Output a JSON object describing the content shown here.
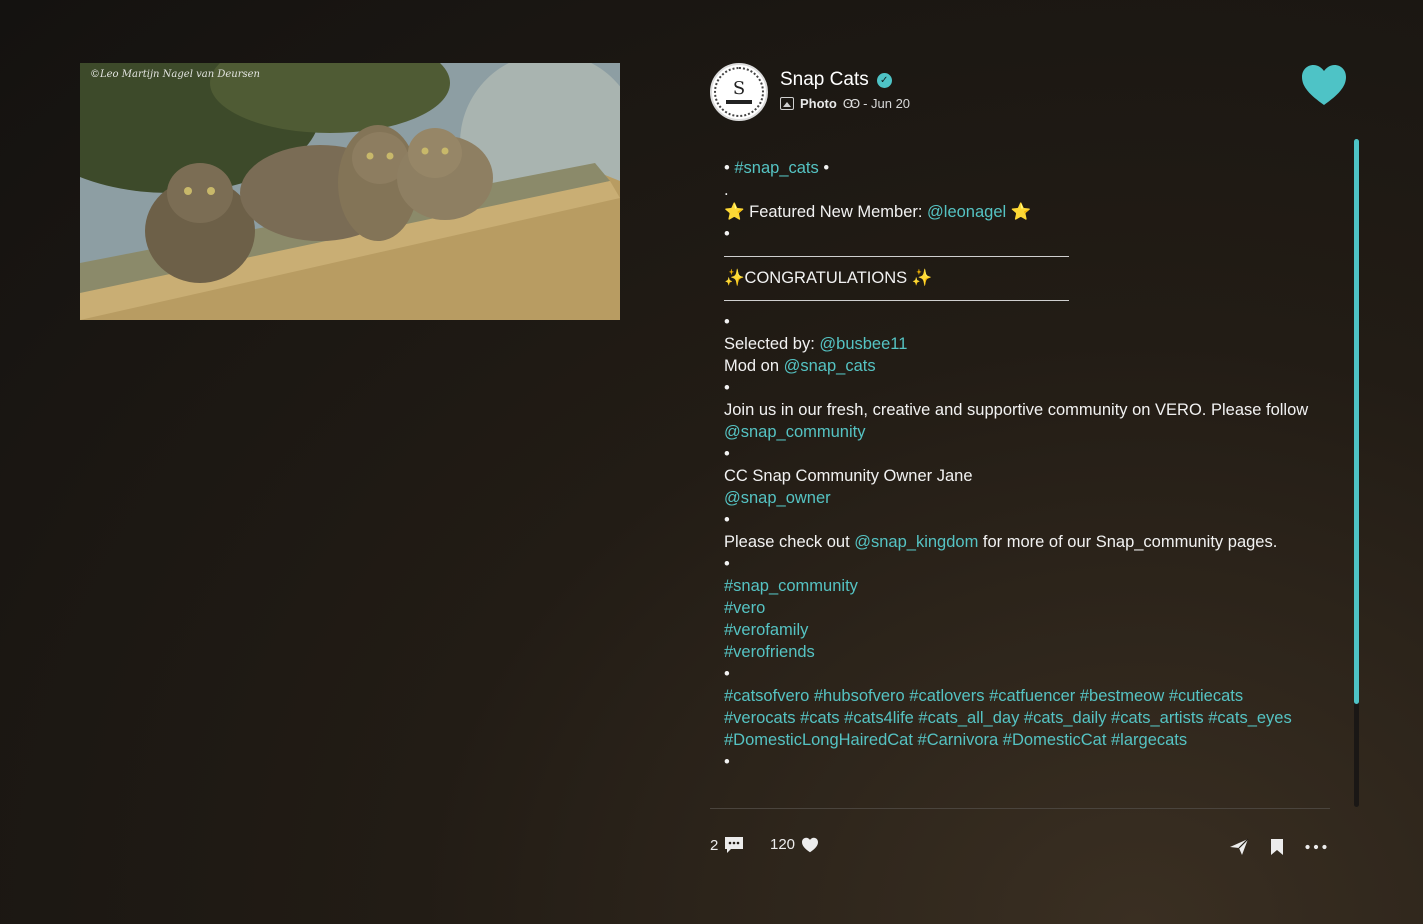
{
  "photo": {
    "watermark": "©Leo Martijn Nagel van Deursen"
  },
  "header": {
    "account_name": "Snap Cats",
    "post_type": "Photo",
    "date": "- Jun 20",
    "avatar_letter": "S"
  },
  "caption": {
    "lines": [
      {
        "parts": [
          {
            "t": "• "
          },
          {
            "t": "#snap_cats",
            "link": true
          },
          {
            "t": " •"
          }
        ]
      },
      {
        "parts": [
          {
            "t": "."
          }
        ]
      },
      {
        "parts": [
          {
            "t": "⭐ Featured New Member: "
          },
          {
            "t": "@leonagel",
            "link": true
          },
          {
            "t": " ⭐"
          }
        ]
      },
      {
        "parts": [
          {
            "t": "•"
          }
        ]
      },
      {
        "divider": true
      },
      {
        "parts": [
          {
            "t": "✨CONGRATULATIONS ✨"
          }
        ]
      },
      {
        "divider": true
      },
      {
        "parts": [
          {
            "t": "•"
          }
        ]
      },
      {
        "parts": [
          {
            "t": "Selected by: "
          },
          {
            "t": "@busbee11",
            "link": true
          }
        ]
      },
      {
        "parts": [
          {
            "t": "Mod on "
          },
          {
            "t": "@snap_cats",
            "link": true
          }
        ]
      },
      {
        "parts": [
          {
            "t": "•"
          }
        ]
      },
      {
        "parts": [
          {
            "t": "Join us in our fresh, creative and supportive community on VERO. Please follow "
          },
          {
            "t": "@snap_community",
            "link": true
          }
        ]
      },
      {
        "parts": [
          {
            "t": "•"
          }
        ]
      },
      {
        "parts": [
          {
            "t": "CC Snap Community Owner Jane"
          }
        ]
      },
      {
        "parts": [
          {
            "t": "@snap_owner",
            "link": true
          }
        ]
      },
      {
        "parts": [
          {
            "t": "•"
          }
        ]
      },
      {
        "parts": [
          {
            "t": "Please check out "
          },
          {
            "t": "@snap_kingdom",
            "link": true
          },
          {
            "t": " for more of our Snap_community pages."
          }
        ]
      },
      {
        "parts": [
          {
            "t": "•"
          }
        ]
      },
      {
        "parts": [
          {
            "t": "#snap_community",
            "link": true
          }
        ]
      },
      {
        "parts": [
          {
            "t": "#vero",
            "link": true
          }
        ]
      },
      {
        "parts": [
          {
            "t": "#verofamily",
            "link": true
          }
        ]
      },
      {
        "parts": [
          {
            "t": "#verofriends",
            "link": true
          }
        ]
      },
      {
        "parts": [
          {
            "t": "•"
          }
        ]
      },
      {
        "parts": [
          {
            "t": "#catsofvero #hubsofvero #catlovers #catfuencer #bestmeow #cutiecats #verocats #cats #cats4life #cats_all_day #cats_daily #cats_artists #cats_eyes #DomesticLongHairedCat #Carnivora #DomesticCat #largecats",
            "link": true
          }
        ]
      },
      {
        "parts": [
          {
            "t": "•"
          }
        ]
      }
    ]
  },
  "actions": {
    "comment_count": "2",
    "like_count": "120"
  },
  "colors": {
    "accent": "#4ec3c6",
    "link": "#55c3c3"
  },
  "icons": {
    "like": "heart-icon",
    "comment": "comment-icon",
    "share": "send-icon",
    "bookmark": "bookmark-icon",
    "more": "more-icon",
    "verified": "verified-icon"
  }
}
